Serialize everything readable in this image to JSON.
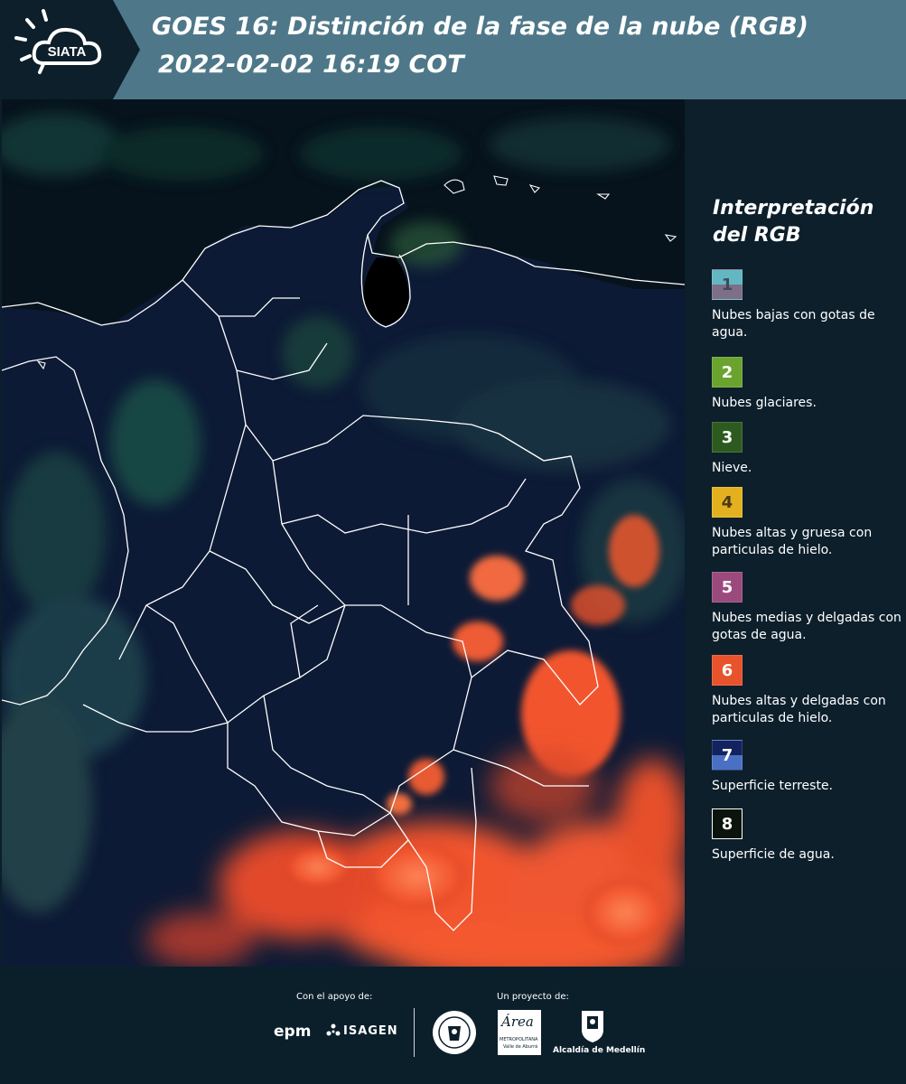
{
  "header": {
    "title": "GOES 16: Distinción de la fase de la nube (RGB)",
    "datetime": "2022-02-02 16:19 COT",
    "logo_text": "SIATA"
  },
  "legend": {
    "title": "Interpretación del RGB",
    "items": [
      {
        "number": "1",
        "label": "Nubes bajas con gotas de agua.",
        "color_top": "#63b7c3",
        "color_bottom": "#7d6f88",
        "text_color": "#404a55"
      },
      {
        "number": "2",
        "label": "Nubes glaciares.",
        "color_top": "#6aa42f",
        "color_bottom": "#6aa42f",
        "text_color": "#ffffff"
      },
      {
        "number": "3",
        "label": "Nieve.",
        "color_top": "#2d5b1f",
        "color_bottom": "#2d5b1f",
        "text_color": "#ffffff"
      },
      {
        "number": "4",
        "label": "Nubes altas y gruesa con particulas de hielo.",
        "color_top": "#e3b120",
        "color_bottom": "#e3b120",
        "text_color": "#4a3a10"
      },
      {
        "number": "5",
        "label": "Nubes medias y delgadas con gotas de agua.",
        "color_top": "#9b4a7e",
        "color_bottom": "#9b4a7e",
        "text_color": "#ffffff"
      },
      {
        "number": "6",
        "label": "Nubes altas y delgadas con particulas de hielo.",
        "color_top": "#e8532c",
        "color_bottom": "#e8532c",
        "text_color": "#ffffff"
      },
      {
        "number": "7",
        "label": "Superficie terreste.",
        "color_top": "#14235e",
        "color_bottom": "#4a70c4",
        "text_color": "#ffffff"
      },
      {
        "number": "8",
        "label": "Superficie de agua.",
        "color_top": "#0a140c",
        "color_bottom": "#0a140c",
        "text_color": "#ffffff"
      }
    ]
  },
  "footer": {
    "support_caption": "Con el apoyo de:",
    "project_caption": "Un proyecto de:",
    "sponsor_epm": "epm",
    "sponsor_isagen": "ISAGEN",
    "partner_area": "Área",
    "partner_area_sub": "METROPOLITANA",
    "partner_area_sub2": "Valle de Aburrá",
    "partner_alcaldia": "Alcaldía de Medellín"
  },
  "colors": {
    "header_bg": "#4e7889",
    "panel_bg": "#0c1f2b",
    "cloud_high": "#ff6a45",
    "land": "#0d1a35"
  }
}
